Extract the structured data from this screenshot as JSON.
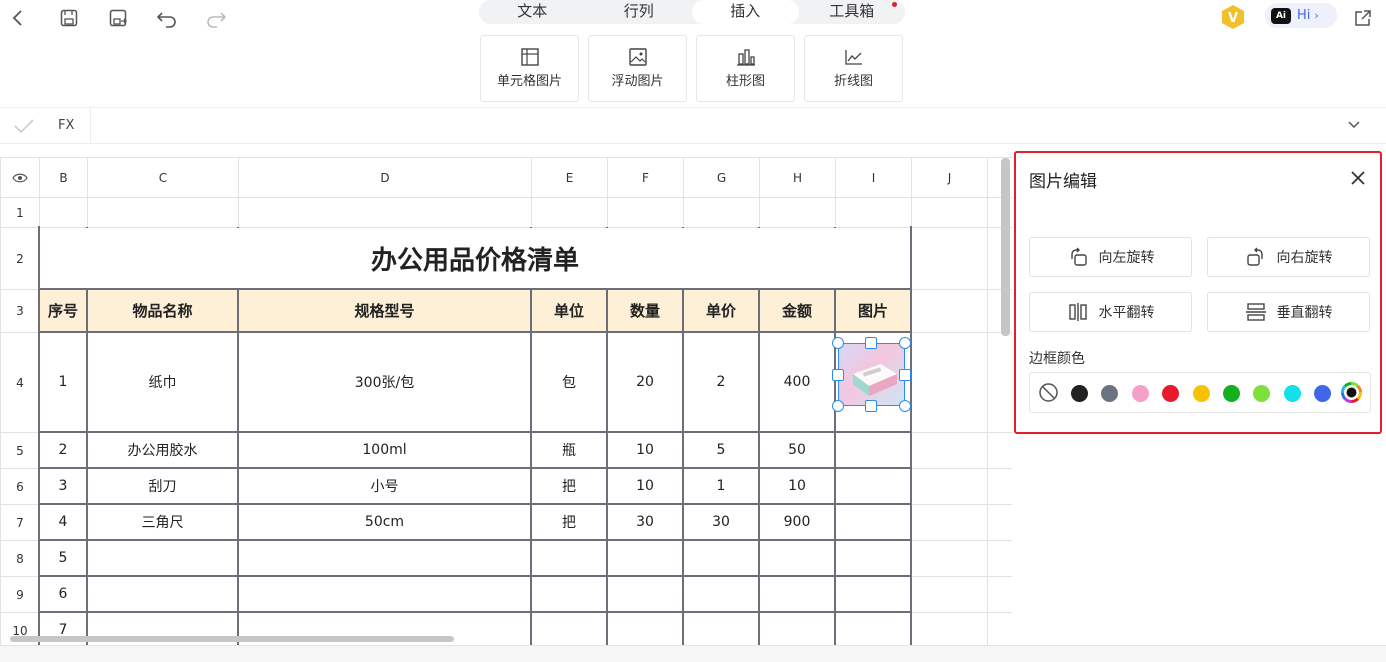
{
  "toolbar": {
    "tabs": [
      "文本",
      "行列",
      "插入",
      "工具箱"
    ],
    "active_tab": "插入",
    "ai_label": "Hi"
  },
  "insert_tools": [
    "单元格图片",
    "浮动图片",
    "柱形图",
    "折线图"
  ],
  "formula": {
    "label": "FX",
    "value": ""
  },
  "columns": [
    "B",
    "C",
    "D",
    "E",
    "F",
    "G",
    "H",
    "I",
    "J"
  ],
  "rows": [
    "1",
    "2",
    "3",
    "4",
    "5",
    "6",
    "7",
    "8",
    "9",
    "10"
  ],
  "sheet": {
    "title": "办公用品价格清单",
    "headers": [
      "序号",
      "物品名称",
      "规格型号",
      "单位",
      "数量",
      "单价",
      "金额",
      "图片"
    ],
    "data": [
      [
        "1",
        "纸巾",
        "300张/包",
        "包",
        "20",
        "2",
        "400"
      ],
      [
        "2",
        "办公用胶水",
        "100ml",
        "瓶",
        "10",
        "5",
        "50"
      ],
      [
        "3",
        "刮刀",
        "小号",
        "把",
        "10",
        "1",
        "10"
      ],
      [
        "4",
        "三角尺",
        "50cm",
        "把",
        "30",
        "30",
        "900"
      ],
      [
        "5",
        "",
        "",
        "",
        "",
        "",
        ""
      ],
      [
        "6",
        "",
        "",
        "",
        "",
        "",
        ""
      ],
      [
        "7",
        "",
        "",
        "",
        "",
        "",
        ""
      ]
    ]
  },
  "panel": {
    "title": "图片编辑",
    "rotate_left": "向左旋转",
    "rotate_right": "向右旋转",
    "flip_horizontal": "水平翻转",
    "flip_vertical": "垂直翻转",
    "border_color_label": "边框颜色",
    "colors": [
      "#222222",
      "#6b7280",
      "#f5a0c8",
      "#e8192c",
      "#f7c300",
      "#13b11b",
      "#7ee03a",
      "#14e0ea",
      "#3f67e8"
    ]
  },
  "accent_color": "#e0202a",
  "header_fill": "#fdf0d7"
}
